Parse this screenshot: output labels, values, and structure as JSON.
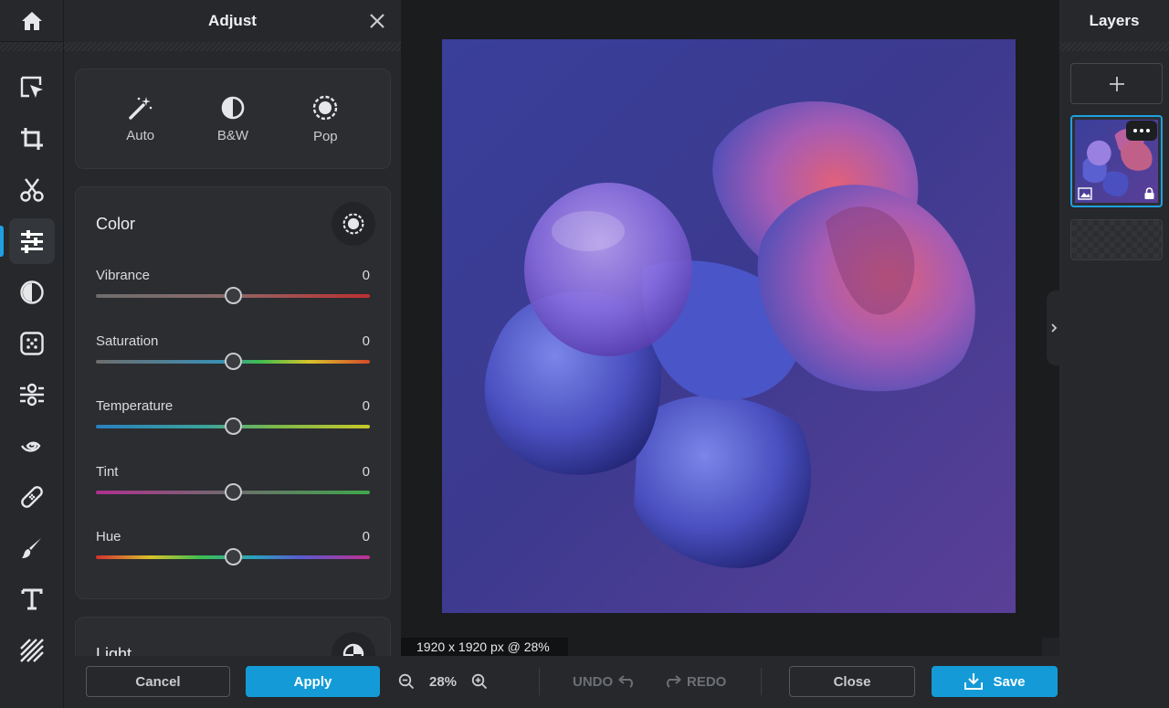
{
  "left_panel": {
    "title": "Adjust"
  },
  "presets": [
    {
      "label": "Auto",
      "icon": "magic-wand-icon"
    },
    {
      "label": "B&W",
      "icon": "half-circle-icon"
    },
    {
      "label": "Pop",
      "icon": "sun-icon"
    }
  ],
  "color_section": {
    "title": "Color",
    "sliders": [
      {
        "label": "Vibrance",
        "value": "0"
      },
      {
        "label": "Saturation",
        "value": "0"
      },
      {
        "label": "Temperature",
        "value": "0"
      },
      {
        "label": "Tint",
        "value": "0"
      },
      {
        "label": "Hue",
        "value": "0"
      }
    ]
  },
  "light_section": {
    "title": "Light"
  },
  "canvas": {
    "dimensions_readout": "1920 x 1920 px @ 28%"
  },
  "layers_panel": {
    "title": "Layers"
  },
  "bottom_bar": {
    "cancel_label": "Cancel",
    "apply_label": "Apply",
    "zoom_level": "28%",
    "undo_label": "UNDO",
    "redo_label": "REDO",
    "close_label": "Close",
    "save_label": "Save"
  },
  "colors": {
    "accent": "#149bd7",
    "panel_bg": "#26282b",
    "canvas_bg": "#1b1c1e"
  }
}
